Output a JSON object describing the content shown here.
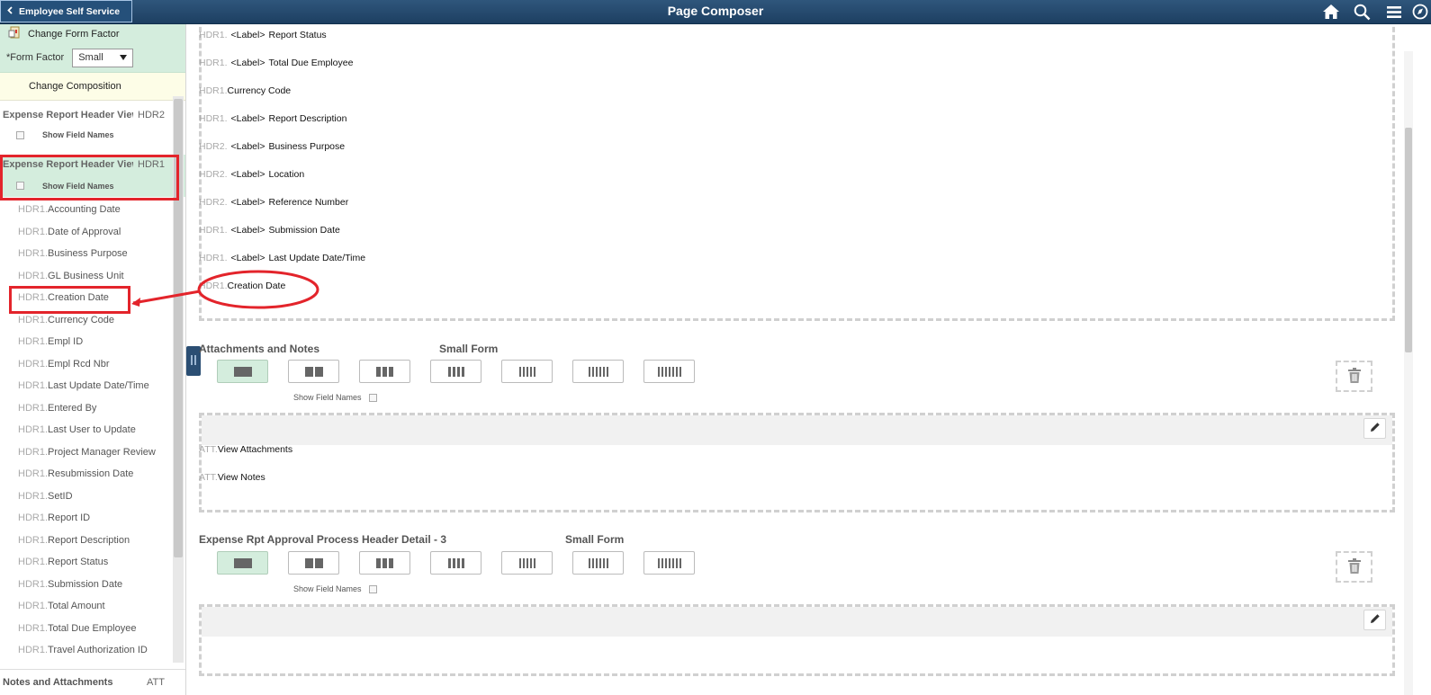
{
  "topbar": {
    "back_label": "Employee Self Service",
    "title": "Page Composer",
    "icons": [
      "home-icon",
      "search-icon",
      "menu-icon",
      "navbar-icon"
    ]
  },
  "left": {
    "change_form_factor": "Change Form Factor",
    "form_factor_label": "*Form Factor",
    "form_factor_value": "Small",
    "change_composition": "Change Composition",
    "groups": [
      {
        "title": "Expense Report Header View",
        "code": "HDR2",
        "show_field_names": "Show Field Names"
      },
      {
        "title": "Expense Report Header View",
        "code": "HDR1",
        "show_field_names": "Show Field Names"
      }
    ],
    "prefix": "HDR1.",
    "fields": [
      "Accounting Date",
      "Date of Approval",
      "Business Purpose",
      "GL Business Unit",
      "Creation Date",
      "Currency Code",
      "Empl ID",
      "Empl Rcd Nbr",
      "Last Update Date/Time",
      "Entered By",
      "Last User to Update",
      "Project Manager Review",
      "Resubmission Date",
      "SetID",
      "Report ID",
      "Report Description",
      "Report Status",
      "Submission Date",
      "Total Amount",
      "Total Due Employee",
      "Travel Authorization ID"
    ],
    "notes_group": {
      "title": "Notes and Attachments",
      "code": "ATT"
    }
  },
  "main": {
    "header_fields": [
      {
        "prefix": "HDR1.",
        "label": "<Label>",
        "name": "Report Status"
      },
      {
        "prefix": "HDR1.",
        "label": "<Label>",
        "name": "Total Due Employee"
      },
      {
        "prefix": "HDR1.",
        "label": "",
        "name": "Currency Code"
      },
      {
        "prefix": "HDR1.",
        "label": "<Label>",
        "name": "Report Description"
      },
      {
        "prefix": "HDR2.",
        "label": "<Label>",
        "name": "Business Purpose"
      },
      {
        "prefix": "HDR2.",
        "label": "<Label>",
        "name": "Location"
      },
      {
        "prefix": "HDR2.",
        "label": "<Label>",
        "name": "Reference Number"
      },
      {
        "prefix": "HDR1.",
        "label": "<Label>",
        "name": "Submission Date"
      },
      {
        "prefix": "HDR1.",
        "label": "<Label>",
        "name": "Last Update Date/Time"
      },
      {
        "prefix": "HDR1.",
        "label": "",
        "name": "Creation Date"
      }
    ],
    "sections": [
      {
        "title": "Attachments and Notes",
        "form": "Small Form",
        "show_field_names": "Show Field Names",
        "fields": [
          {
            "prefix": "ATT.",
            "name": "View Attachments"
          },
          {
            "prefix": "ATT.",
            "name": "View Notes"
          }
        ]
      },
      {
        "title": "Expense Rpt Approval Process Header Detail - 3",
        "form": "Small Form",
        "show_field_names": "Show Field Names",
        "fields": []
      }
    ],
    "layout_options": [
      1,
      2,
      3,
      4,
      5,
      6,
      7
    ]
  }
}
